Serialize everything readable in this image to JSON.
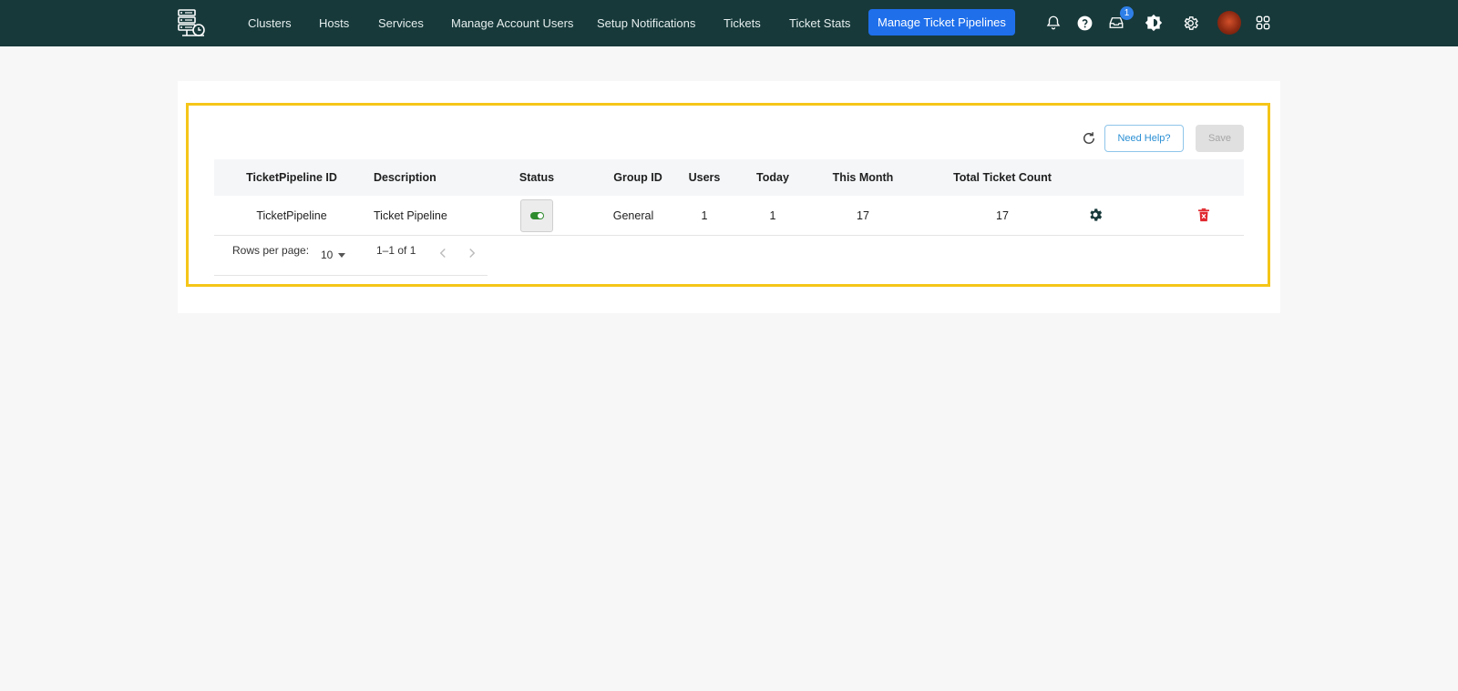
{
  "nav": {
    "items": [
      {
        "label": "Clusters"
      },
      {
        "label": "Hosts"
      },
      {
        "label": "Services"
      },
      {
        "label": "Manage Account Users"
      },
      {
        "label": "Setup Notifications"
      },
      {
        "label": "Tickets"
      },
      {
        "label": "Ticket Stats"
      }
    ],
    "active": {
      "label": "Manage Ticket Pipelines"
    },
    "inbox_badge": "1",
    "icons": [
      "bell-icon",
      "help-icon",
      "inbox-icon",
      "theme-icon",
      "gear-icon",
      "avatar",
      "apps-grid-icon"
    ]
  },
  "toolbar": {
    "help_label": "Need Help?",
    "save_label": "Save"
  },
  "table": {
    "columns": [
      "TicketPipeline ID",
      "Description",
      "Status",
      "Group ID",
      "Users",
      "Today",
      "This Month",
      "Total Ticket Count"
    ],
    "rows": [
      {
        "id": "TicketPipeline",
        "description": "Ticket Pipeline",
        "status": "enabled",
        "group_id": "General",
        "users": "1",
        "today": "1",
        "this_month": "17",
        "total": "17"
      }
    ]
  },
  "pagination": {
    "rows_per_page_label": "Rows per page:",
    "rows_per_page": "10",
    "range": "1–1 of 1"
  },
  "colors": {
    "topbar": "#17393a",
    "accent": "#1f6feb",
    "highlight": "#f5c518",
    "toggle_on": "#2e8b2e",
    "delete": "#e0282e"
  }
}
